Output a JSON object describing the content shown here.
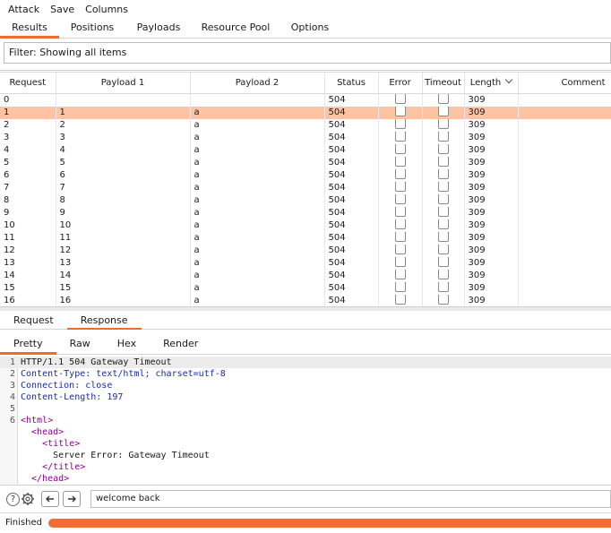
{
  "menu": [
    "Attack",
    "Save",
    "Columns"
  ],
  "tabs": [
    "Results",
    "Positions",
    "Payloads",
    "Resource Pool",
    "Options"
  ],
  "active_tab": "Results",
  "filter_text": "Filter: Showing all items",
  "table": {
    "headers": [
      "Request",
      "Payload 1",
      "Payload 2",
      "Status",
      "Error",
      "Timeout",
      "Length",
      "Comment"
    ],
    "sort_column": "Length",
    "selected_row": 1,
    "rows": [
      {
        "req": "0",
        "p1": "",
        "p2": "",
        "status": "504",
        "len": "309"
      },
      {
        "req": "1",
        "p1": "1",
        "p2": "a",
        "status": "504",
        "len": "309"
      },
      {
        "req": "2",
        "p1": "2",
        "p2": "a",
        "status": "504",
        "len": "309"
      },
      {
        "req": "3",
        "p1": "3",
        "p2": "a",
        "status": "504",
        "len": "309"
      },
      {
        "req": "4",
        "p1": "4",
        "p2": "a",
        "status": "504",
        "len": "309"
      },
      {
        "req": "5",
        "p1": "5",
        "p2": "a",
        "status": "504",
        "len": "309"
      },
      {
        "req": "6",
        "p1": "6",
        "p2": "a",
        "status": "504",
        "len": "309"
      },
      {
        "req": "7",
        "p1": "7",
        "p2": "a",
        "status": "504",
        "len": "309"
      },
      {
        "req": "8",
        "p1": "8",
        "p2": "a",
        "status": "504",
        "len": "309"
      },
      {
        "req": "9",
        "p1": "9",
        "p2": "a",
        "status": "504",
        "len": "309"
      },
      {
        "req": "10",
        "p1": "10",
        "p2": "a",
        "status": "504",
        "len": "309"
      },
      {
        "req": "11",
        "p1": "11",
        "p2": "a",
        "status": "504",
        "len": "309"
      },
      {
        "req": "12",
        "p1": "12",
        "p2": "a",
        "status": "504",
        "len": "309"
      },
      {
        "req": "13",
        "p1": "13",
        "p2": "a",
        "status": "504",
        "len": "309"
      },
      {
        "req": "14",
        "p1": "14",
        "p2": "a",
        "status": "504",
        "len": "309"
      },
      {
        "req": "15",
        "p1": "15",
        "p2": "a",
        "status": "504",
        "len": "309"
      },
      {
        "req": "16",
        "p1": "16",
        "p2": "a",
        "status": "504",
        "len": "309"
      }
    ]
  },
  "sub_tabs": [
    "Request",
    "Response"
  ],
  "active_sub_tab": "Response",
  "view_tabs": [
    "Pretty",
    "Raw",
    "Hex",
    "Render"
  ],
  "active_view_tab": "Pretty",
  "editor_lines": [
    {
      "n": "1",
      "text": "HTTP/1.1 504 Gateway Timeout"
    },
    {
      "n": "2",
      "text": "Content-Type: text/html; charset=utf-8"
    },
    {
      "n": "3",
      "text": "Connection: close"
    },
    {
      "n": "4",
      "text": "Content-Length: 197"
    },
    {
      "n": "5",
      "text": ""
    },
    {
      "n": "6",
      "text": "<html>"
    },
    {
      "n": "",
      "text": "  <head>"
    },
    {
      "n": "",
      "text": "    <title>"
    },
    {
      "n": "",
      "text": "      Server Error: Gateway Timeout"
    },
    {
      "n": "",
      "text": "    </title>"
    },
    {
      "n": "",
      "text": "  </head>"
    }
  ],
  "search_value": "welcome back",
  "status_text": "Finished",
  "progress": 1.0,
  "colors": {
    "accent": "#f26a32",
    "selected_row": "#fbc4a4",
    "progress": "#f36c36"
  },
  "icons": [
    "help-icon",
    "settings-icon",
    "arrow-left-icon",
    "arrow-right-icon"
  ]
}
